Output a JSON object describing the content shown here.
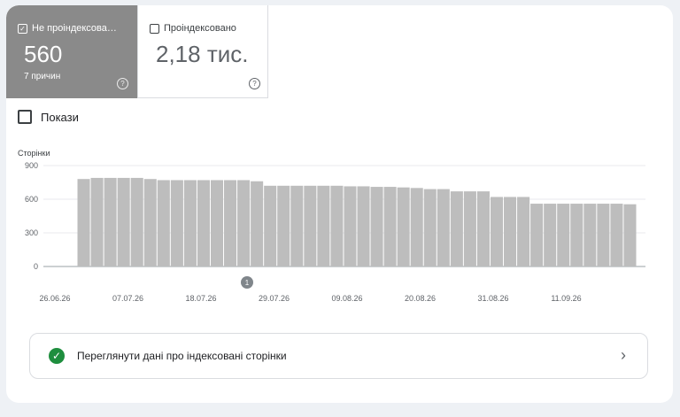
{
  "tiles": [
    {
      "label": "Не проіндексова…",
      "value": "560",
      "sub": "7 причин",
      "checked": true
    },
    {
      "label": "Проіндексовано",
      "value": "2,18 тис.",
      "checked": false
    }
  ],
  "show_label": "Покази",
  "link_label": "Переглянути дані про індексовані сторінки",
  "colors": {
    "bar": "#bdbdbd",
    "active_tile": "#8a8a8a",
    "success": "#1e8e3e"
  },
  "chart_data": {
    "type": "bar",
    "ylabel": "Сторінки",
    "ylim": [
      0,
      900
    ],
    "yticks": [
      0,
      300,
      600,
      900
    ],
    "xticks": [
      "26.06.26",
      "07.07.26",
      "18.07.26",
      "29.07.26",
      "09.08.26",
      "20.08.26",
      "31.08.26",
      "11.09.26"
    ],
    "annotation": {
      "label": "1",
      "x": "28.07.26"
    },
    "x": [
      "30.06.26",
      "02.07.26",
      "04.07.26",
      "06.07.26",
      "08.07.26",
      "10.07.26",
      "12.07.26",
      "14.07.26",
      "16.07.26",
      "18.07.26",
      "20.07.26",
      "22.07.26",
      "24.07.26",
      "26.07.26",
      "28.07.26",
      "30.07.26",
      "01.08.26",
      "03.08.26",
      "05.08.26",
      "07.08.26",
      "09.08.26",
      "11.08.26",
      "13.08.26",
      "15.08.26",
      "17.08.26",
      "19.08.26",
      "21.08.26",
      "23.08.26",
      "25.08.26",
      "27.08.26",
      "29.08.26",
      "31.08.26",
      "02.09.26",
      "04.09.26",
      "06.09.26",
      "08.09.26",
      "10.09.26",
      "12.09.26",
      "14.09.26",
      "16.09.26",
      "18.09.26",
      "20.09.26"
    ],
    "values": [
      780,
      790,
      790,
      790,
      790,
      780,
      770,
      770,
      770,
      770,
      770,
      770,
      770,
      760,
      720,
      720,
      720,
      720,
      720,
      720,
      715,
      715,
      710,
      710,
      705,
      700,
      690,
      690,
      670,
      670,
      670,
      620,
      620,
      620,
      560,
      560,
      560,
      560,
      560,
      560,
      560,
      555
    ]
  }
}
